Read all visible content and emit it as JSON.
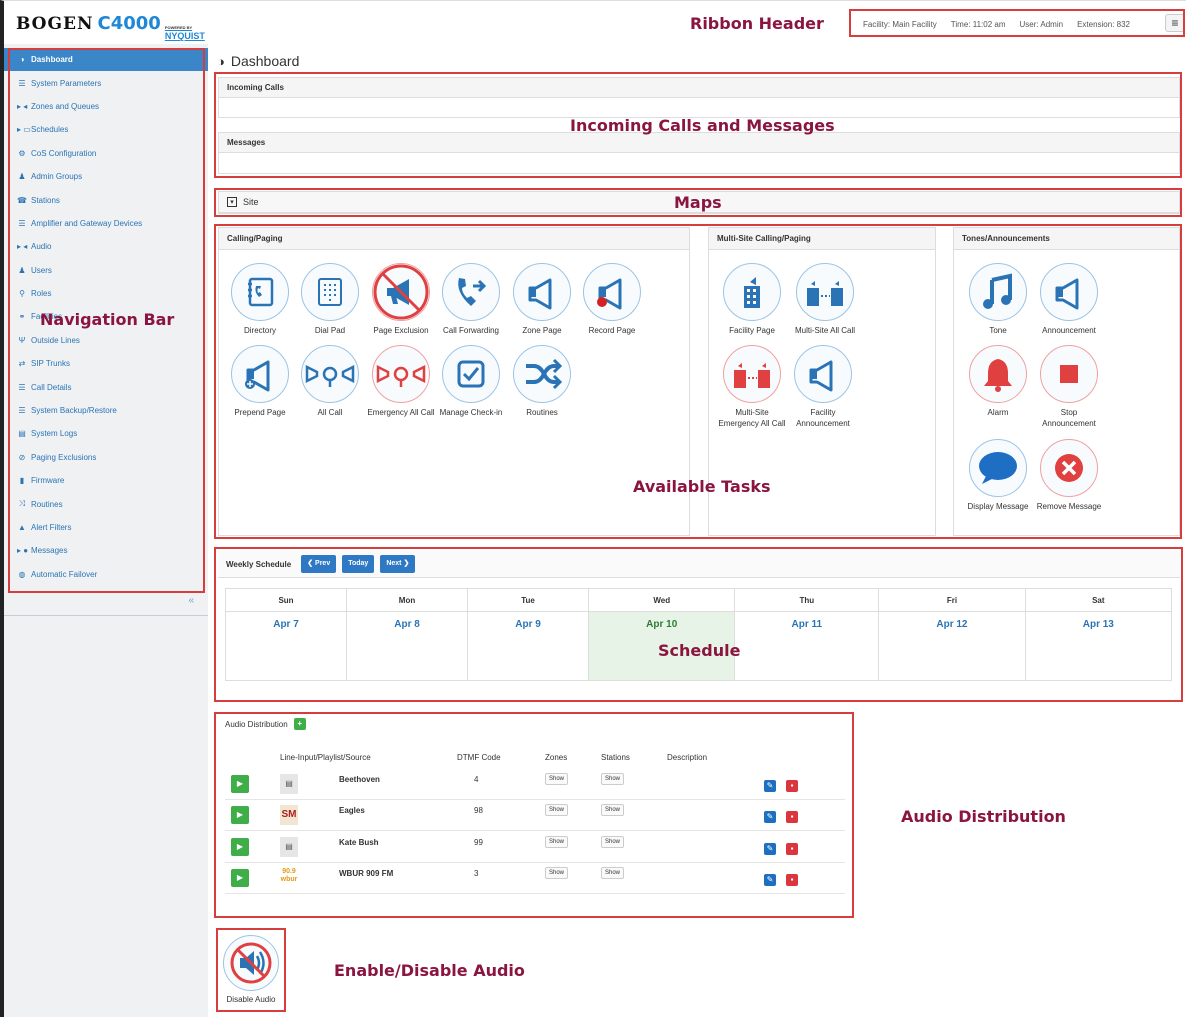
{
  "header": {
    "logo_brand": "BOGEN",
    "logo_model": "C4000",
    "logo_powered": "POWERED BY",
    "logo_nyquist": "NYQUIST",
    "facility": "Facility: Main Facility",
    "time": "Time: 11:02 am",
    "user": "User: Admin",
    "extension": "Extension: 832",
    "menu_icon": "≡"
  },
  "sidebar": {
    "items": [
      {
        "label": "Dashboard",
        "icon": "dashboard-icon",
        "glyph": "◑"
      },
      {
        "label": "System Parameters",
        "icon": "list-icon",
        "glyph": "☰"
      },
      {
        "label": "Zones and Queues",
        "icon": "speaker-icon",
        "glyph": "▸ ◂"
      },
      {
        "label": "Schedules",
        "icon": "calendar-icon",
        "glyph": "▸ ▭"
      },
      {
        "label": "CoS Configuration",
        "icon": "gears-icon",
        "glyph": "⚙"
      },
      {
        "label": "Admin Groups",
        "icon": "group-icon",
        "glyph": "♟"
      },
      {
        "label": "Stations",
        "icon": "phone-icon",
        "glyph": "☎"
      },
      {
        "label": "Amplifier and Gateway Devices",
        "icon": "server-icon",
        "glyph": "☰"
      },
      {
        "label": "Audio",
        "icon": "audio-icon",
        "glyph": "▸ ◂"
      },
      {
        "label": "Users",
        "icon": "user-icon",
        "glyph": "♟"
      },
      {
        "label": "Roles",
        "icon": "key-icon",
        "glyph": "⚲"
      },
      {
        "label": "Facilities",
        "icon": "sitemap-icon",
        "glyph": "⚭"
      },
      {
        "label": "Outside Lines",
        "icon": "outside-line-icon",
        "glyph": "Ψ"
      },
      {
        "label": "SIP Trunks",
        "icon": "exchange-icon",
        "glyph": "⇄"
      },
      {
        "label": "Call Details",
        "icon": "table-icon",
        "glyph": "☰"
      },
      {
        "label": "System Backup/Restore",
        "icon": "database-icon",
        "glyph": "☰"
      },
      {
        "label": "System Logs",
        "icon": "file-icon",
        "glyph": "▤"
      },
      {
        "label": "Paging Exclusions",
        "icon": "ban-icon",
        "glyph": "⊘"
      },
      {
        "label": "Firmware",
        "icon": "firmware-icon",
        "glyph": "▮"
      },
      {
        "label": "Routines",
        "icon": "random-icon",
        "glyph": "⤨"
      },
      {
        "label": "Alert Filters",
        "icon": "warning-icon",
        "glyph": "▲"
      },
      {
        "label": "Messages",
        "icon": "comment-icon",
        "glyph": "▸ ●"
      },
      {
        "label": "Automatic Failover",
        "icon": "shield-icon",
        "glyph": "◍"
      }
    ],
    "collapse": "«"
  },
  "main": {
    "title": "Dashboard",
    "incoming_calls": "Incoming Calls",
    "messages": "Messages",
    "site": "Site",
    "calling_paging": "Calling/Paging",
    "multi_site": "Multi-Site Calling/Paging",
    "tones": "Tones/Announcements",
    "tasks_calling": [
      {
        "label": "Directory",
        "icon": "directory-icon"
      },
      {
        "label": "Dial Pad",
        "icon": "dialpad-icon"
      },
      {
        "label": "Page Exclusion",
        "icon": "page-exclusion-icon"
      },
      {
        "label": "Call Forwarding",
        "icon": "call-forwarding-icon"
      },
      {
        "label": "Zone Page",
        "icon": "zone-page-icon"
      },
      {
        "label": "Record Page",
        "icon": "record-page-icon"
      },
      {
        "label": "Prepend Page",
        "icon": "prepend-page-icon"
      },
      {
        "label": "All Call",
        "icon": "all-call-icon"
      },
      {
        "label": "Emergency All Call",
        "icon": "emergency-all-call-icon"
      },
      {
        "label": "Manage Check-in",
        "icon": "check-in-icon"
      },
      {
        "label": "Routines",
        "icon": "routines-icon"
      }
    ],
    "tasks_multi": [
      {
        "label": "Facility Page",
        "icon": "facility-page-icon"
      },
      {
        "label": "Multi-Site All Call",
        "icon": "multi-site-all-call-icon"
      },
      {
        "label": "Multi-Site Emergency All Call",
        "icon": "multi-site-emergency-icon"
      },
      {
        "label": "Facility Announcement",
        "icon": "facility-announcement-icon"
      }
    ],
    "tasks_tones": [
      {
        "label": "Tone",
        "icon": "tone-icon"
      },
      {
        "label": "Announcement",
        "icon": "announcement-icon"
      },
      {
        "label": "Alarm",
        "icon": "alarm-icon"
      },
      {
        "label": "Stop Announcement",
        "icon": "stop-icon"
      },
      {
        "label": "Display Message",
        "icon": "display-message-icon"
      },
      {
        "label": "Remove Message",
        "icon": "remove-message-icon"
      }
    ]
  },
  "schedule": {
    "title": "Weekly Schedule",
    "prev": "❮ Prev",
    "today": "Today",
    "next": "Next ❯",
    "days": [
      "Sun",
      "Mon",
      "Tue",
      "Wed",
      "Thu",
      "Fri",
      "Sat"
    ],
    "dates": [
      "Apr 7",
      "Apr 8",
      "Apr 9",
      "Apr 10",
      "Apr 11",
      "Apr 12",
      "Apr 13"
    ]
  },
  "audio": {
    "title": "Audio Distribution",
    "add": "+",
    "cols": [
      "Line-Input/Playlist/Source",
      "DTMF Code",
      "Zones",
      "Stations",
      "Description"
    ],
    "rows": [
      {
        "name": "Beethoven",
        "code": "4",
        "zones": "Show",
        "stations": "Show",
        "thumb": "▤"
      },
      {
        "name": "Eagles",
        "code": "98",
        "zones": "Show",
        "stations": "Show",
        "thumb": "SM"
      },
      {
        "name": "Kate Bush",
        "code": "99",
        "zones": "Show",
        "stations": "Show",
        "thumb": "▤"
      },
      {
        "name": "WBUR 909 FM",
        "code": "3",
        "zones": "Show",
        "stations": "Show",
        "thumb": "90.9 wbur"
      }
    ],
    "disable": "Disable Audio"
  },
  "callouts": {
    "ribbon": "Ribbon Header",
    "nav": "Navigation Bar",
    "incoming": "Incoming Calls and Messages",
    "maps": "Maps",
    "tasks": "Available Tasks",
    "schedule": "Schedule",
    "audio": "Audio Distribution",
    "enable": "Enable/Disable Audio"
  },
  "colors": {
    "accent": "#3a86c8",
    "callout_border": "#d63d3d",
    "callout_text": "#8a1540",
    "play": "#3fae49",
    "today": "#e6f3e6"
  }
}
